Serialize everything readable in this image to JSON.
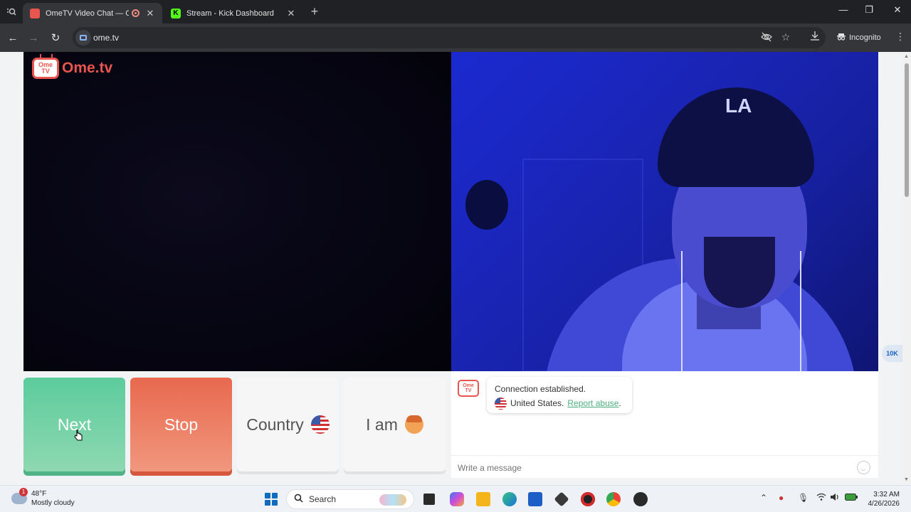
{
  "browser": {
    "tabs": [
      {
        "title": "OmeTV Video Chat — Ome",
        "active": true
      },
      {
        "title": "Stream - Kick Dashboard",
        "active": false
      }
    ],
    "url": "ome.tv",
    "profile": "Incognito"
  },
  "app": {
    "logo_box": "Ome TV",
    "logo_text": "Ome.tv"
  },
  "video": {
    "stranger_cap_logo": "LA"
  },
  "controls": {
    "next_label": "Next",
    "stop_label": "Stop",
    "country_label": "Country",
    "iam_label": "I am"
  },
  "chat": {
    "status_line": "Connection established.",
    "country": "United States.",
    "report_link": "Report abuse",
    "report_suffix": ".",
    "input_placeholder": "Write a message"
  },
  "side_widget": {
    "label": "10K"
  },
  "taskbar": {
    "weather_badge": "1",
    "temperature": "48°F",
    "condition": "Mostly cloudy",
    "search_label": "Search",
    "time": "3:32 AM",
    "date": "4/26/2026"
  },
  "colors": {
    "accent_green": "#5ccc9c",
    "accent_red": "#e8694e",
    "brand": "#e8554e"
  }
}
